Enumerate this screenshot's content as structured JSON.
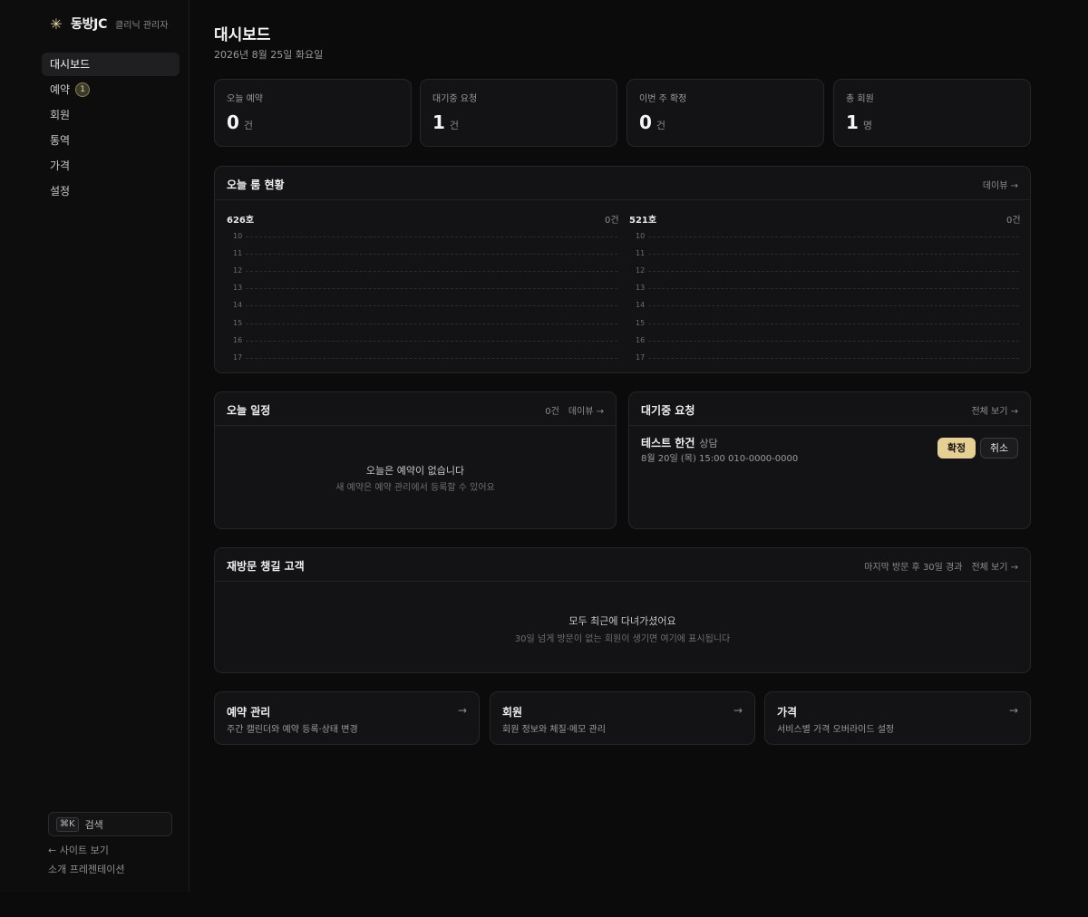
{
  "brand": {
    "name": "동방JC",
    "sub": "클리닉 관리자"
  },
  "nav": {
    "items": [
      {
        "label": "대시보드"
      },
      {
        "label": "예약",
        "badge": "1"
      },
      {
        "label": "회원"
      },
      {
        "label": "통역"
      },
      {
        "label": "가격"
      },
      {
        "label": "설정"
      }
    ]
  },
  "sidebar_footer": {
    "kbd": "⌘K",
    "search_label": "검색",
    "site_link": "← 사이트 보기",
    "intro_link": "소개 프레젠테이션"
  },
  "header": {
    "title": "대시보드",
    "date": "2026년 8월 25일 화요일"
  },
  "stats": [
    {
      "label": "오늘 예약",
      "value": "0",
      "unit": "건"
    },
    {
      "label": "대기중 요청",
      "value": "1",
      "unit": "건"
    },
    {
      "label": "이번 주 확정",
      "value": "0",
      "unit": "건"
    },
    {
      "label": "총 회원",
      "value": "1",
      "unit": "명"
    }
  ],
  "rooms_panel": {
    "title": "오늘 룸 현황",
    "link": "데이뷰 →",
    "hours": [
      "10",
      "11",
      "12",
      "13",
      "14",
      "15",
      "16",
      "17"
    ],
    "rooms": [
      {
        "name": "626호",
        "count": "0건"
      },
      {
        "name": "521호",
        "count": "0건"
      }
    ]
  },
  "today_schedule": {
    "title": "오늘 일정",
    "count": "0건",
    "link": "데이뷰 →",
    "empty_title": "오늘은 예약이 없습니다",
    "empty_sub": "새 예약은 예약 관리에서 등록할 수 있어요"
  },
  "pending": {
    "title": "대기중 요청",
    "link": "전체 보기 →",
    "item": {
      "name": "테스트 한건",
      "type": "상담",
      "meta": "8월 20일 (목) 15:00 010-0000-0000",
      "confirm": "확정",
      "cancel": "취소"
    }
  },
  "revisit": {
    "title": "재방문 챙길 고객",
    "note": "마지막 방문 후 30일 경과",
    "link": "전체 보기 →",
    "empty_title": "모두 최근에 다녀가셨어요",
    "empty_sub": "30일 넘게 방문이 없는 회원이 생기면 여기에 표시됩니다"
  },
  "quick_links": [
    {
      "title": "예약 관리",
      "desc": "주간 캘린더와 예약 등록·상태 변경",
      "arrow": "→"
    },
    {
      "title": "회원",
      "desc": "회원 정보와 체질·메모 관리",
      "arrow": "→"
    },
    {
      "title": "가격",
      "desc": "서비스별 가격 오버라이드 설정",
      "arrow": "→"
    }
  ],
  "colors": {
    "accent": "#e6cf95",
    "background": "#0b0b0c",
    "card": "#131315"
  }
}
